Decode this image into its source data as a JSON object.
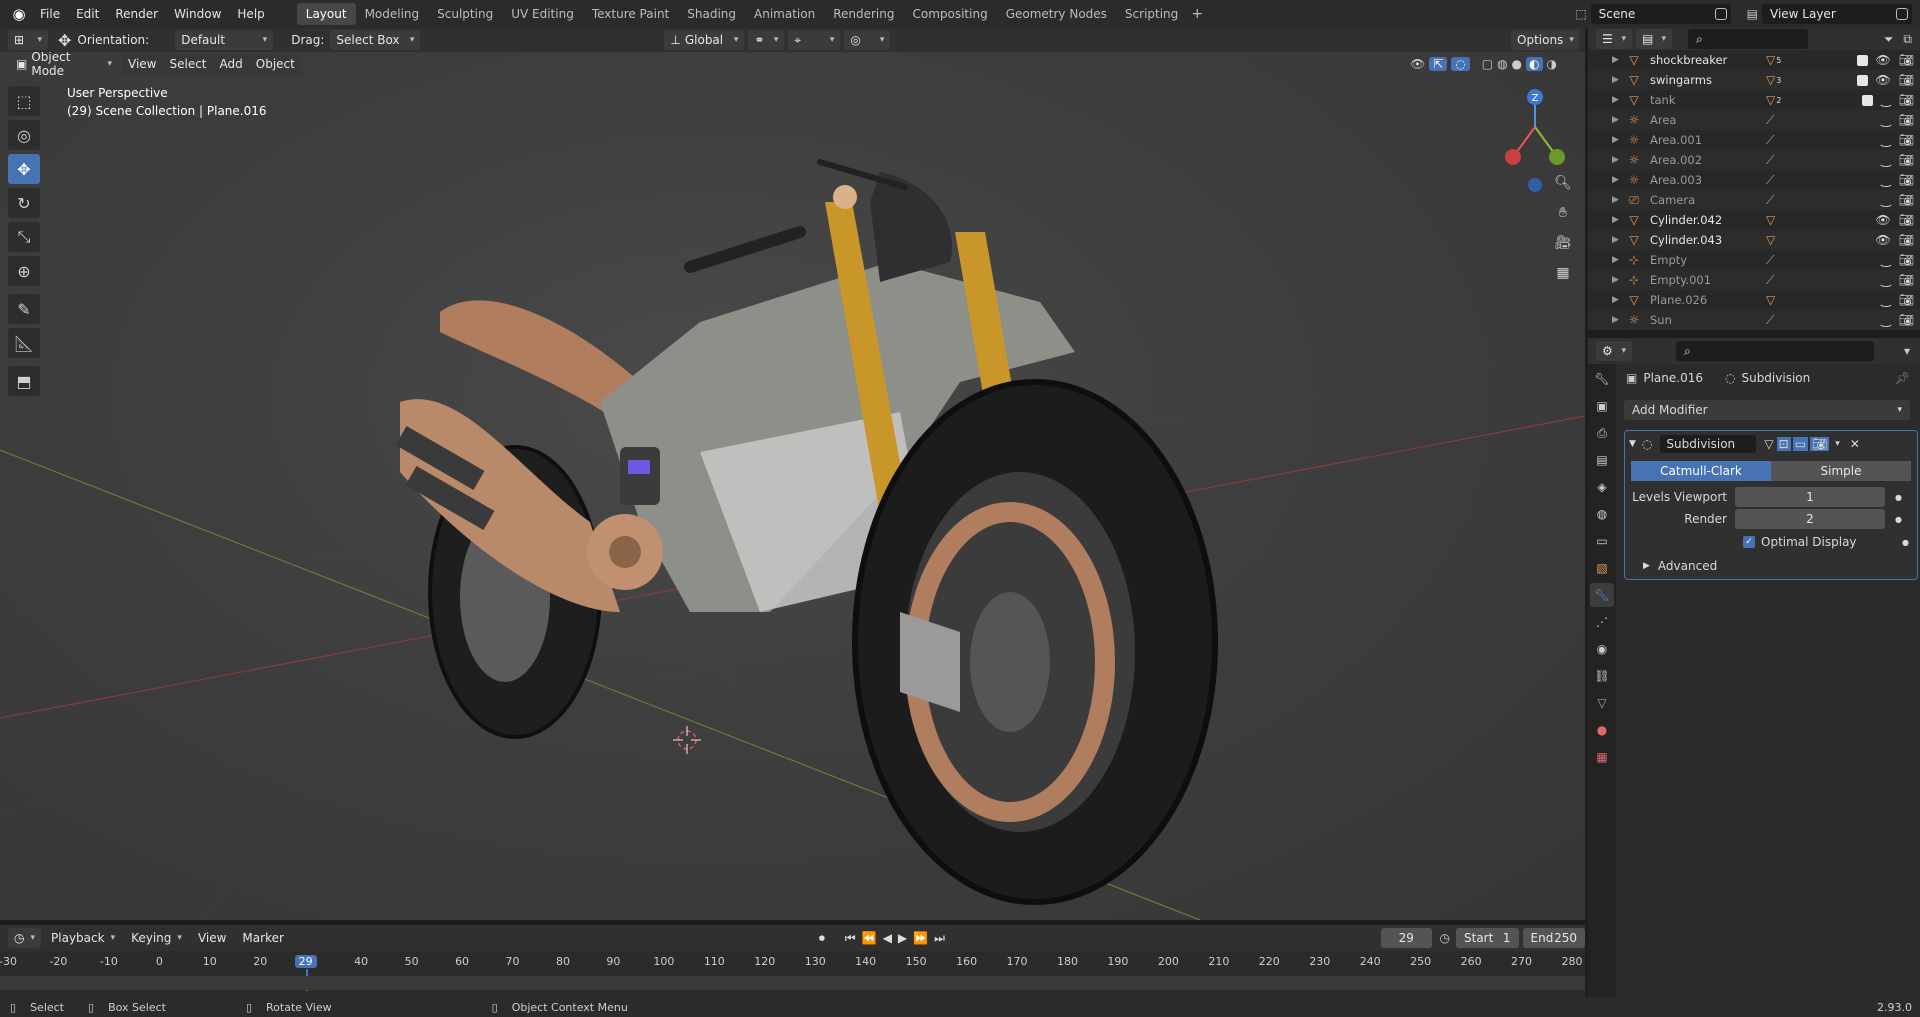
{
  "app": {
    "version": "2.93.0"
  },
  "menu": [
    "File",
    "Edit",
    "Render",
    "Window",
    "Help"
  ],
  "workspaces": [
    "Layout",
    "Modeling",
    "Sculpting",
    "UV Editing",
    "Texture Paint",
    "Shading",
    "Animation",
    "Rendering",
    "Compositing",
    "Geometry Nodes",
    "Scripting"
  ],
  "workspace_add": "+",
  "scene": {
    "name": "Scene",
    "view_layer": "View Layer"
  },
  "viewport_header": {
    "orientation_label": "Orientation:",
    "orientation_value": "Default",
    "drag_label": "Drag:",
    "drag_value": "Select Box",
    "transform_orientation": "Global",
    "options": "Options"
  },
  "viewport_header2": {
    "mode": "Object Mode",
    "menus": [
      "View",
      "Select",
      "Add",
      "Object"
    ]
  },
  "viewport": {
    "perspective": "User Perspective",
    "collection": "(29) Scene Collection | Plane.016",
    "gizmo": {
      "z": "Z"
    }
  },
  "toolbar": [
    "select-box",
    "cursor",
    "move",
    "rotate",
    "scale",
    "transform",
    "annotate",
    "measure",
    "add-cube"
  ],
  "timeline": {
    "menus": [
      "Playback",
      "Keying",
      "View",
      "Marker"
    ],
    "current_frame": "29",
    "start_label": "Start",
    "start": "1",
    "end_label": "End",
    "end": "250",
    "ticks": [
      "-30",
      "-20",
      "-10",
      "0",
      "10",
      "20",
      "29",
      "40",
      "50",
      "60",
      "70",
      "80",
      "90",
      "100",
      "110",
      "120",
      "130",
      "140",
      "150",
      "160",
      "170",
      "180",
      "190",
      "200",
      "210",
      "220",
      "230",
      "240",
      "250",
      "260",
      "270",
      "280"
    ]
  },
  "statusbar": {
    "select": "Select",
    "box_select": "Box Select",
    "rotate_view": "Rotate View",
    "context_menu": "Object Context Menu",
    "version": "2.93.0"
  },
  "outliner": {
    "rows": [
      {
        "name": "shockbreaker",
        "type": "mesh",
        "dim": false,
        "badge": "5",
        "checkbox": true
      },
      {
        "name": "swingarms",
        "type": "mesh",
        "dim": false,
        "badge": "3",
        "checkbox": true
      },
      {
        "name": "tank",
        "type": "mesh",
        "dim": true,
        "badge": "2",
        "checkbox": true
      },
      {
        "name": "Area",
        "type": "light",
        "dim": true,
        "badge": "",
        "checkbox": false
      },
      {
        "name": "Area.001",
        "type": "light",
        "dim": true,
        "badge": "",
        "checkbox": false
      },
      {
        "name": "Area.002",
        "type": "light",
        "dim": true,
        "badge": "",
        "checkbox": false
      },
      {
        "name": "Area.003",
        "type": "light",
        "dim": true,
        "badge": "",
        "checkbox": false
      },
      {
        "name": "Camera",
        "type": "camera",
        "dim": true,
        "badge": "",
        "checkbox": false
      },
      {
        "name": "Cylinder.042",
        "type": "mesh",
        "dim": false,
        "badge": "",
        "checkbox": false
      },
      {
        "name": "Cylinder.043",
        "type": "mesh",
        "dim": false,
        "badge": "",
        "checkbox": false
      },
      {
        "name": "Empty",
        "type": "empty",
        "dim": true,
        "badge": "",
        "checkbox": false
      },
      {
        "name": "Empty.001",
        "type": "empty",
        "dim": true,
        "badge": "",
        "checkbox": false
      },
      {
        "name": "Plane.026",
        "type": "mesh",
        "dim": true,
        "badge": "",
        "checkbox": false
      },
      {
        "name": "Sun",
        "type": "light",
        "dim": true,
        "badge": "",
        "checkbox": false
      }
    ]
  },
  "properties": {
    "object": "Plane.016",
    "modifier_context": "Subdivision",
    "add_modifier": "Add Modifier",
    "modifier": {
      "name": "Subdivision",
      "algo_options": [
        "Catmull-Clark",
        "Simple"
      ],
      "selected_algo": "Catmull-Clark",
      "levels_viewport_label": "Levels Viewport",
      "levels_viewport": "1",
      "render_label": "Render",
      "render": "2",
      "optimal_display_label": "Optimal Display",
      "advanced": "Advanced"
    }
  },
  "colors": {
    "accent": "#4772b3",
    "panel": "#303030",
    "bg": "#1d1d1d",
    "object_orange": "#e89a56",
    "mesh_green": "#7ec27a"
  }
}
